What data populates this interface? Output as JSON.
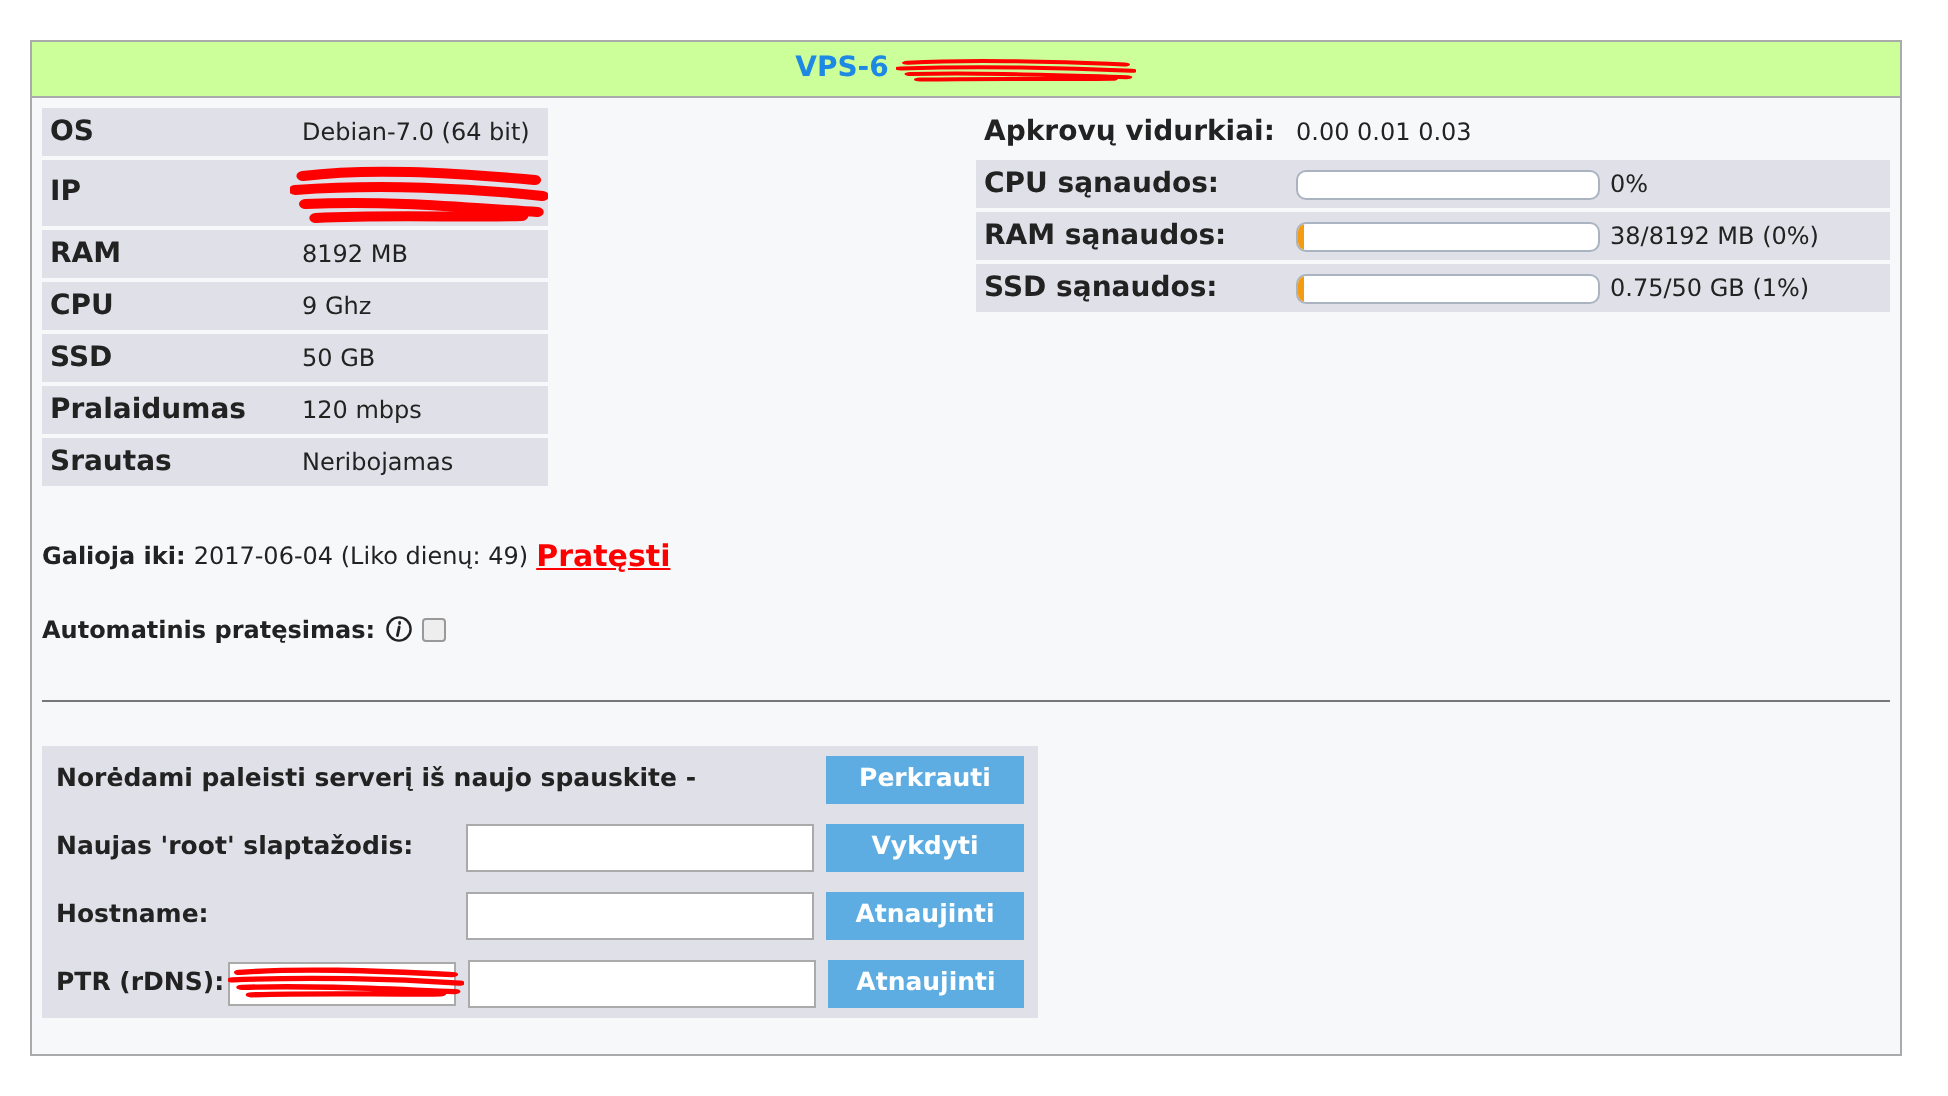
{
  "header": {
    "title": "VPS-6"
  },
  "specs": [
    {
      "label": "OS",
      "value": "Debian-7.0 (64 bit)"
    },
    {
      "label": "IP",
      "kind": "redacted"
    },
    {
      "label": "RAM",
      "value": "8192 MB"
    },
    {
      "label": "CPU",
      "value": "9 Ghz"
    },
    {
      "label": "SSD",
      "value": "50 GB"
    },
    {
      "label": "Pralaidumas",
      "value": "120 mbps"
    },
    {
      "label": "Srautas",
      "value": "Neribojamas"
    }
  ],
  "load": {
    "label": "Apkrovų vidurkiai:",
    "value": "0.00 0.01 0.03"
  },
  "usage": [
    {
      "label": "CPU sąnaudos:",
      "reading": "0%"
    },
    {
      "label": "RAM sąnaudos:",
      "level": 0.02,
      "reading": "38/8192 MB (0%)"
    },
    {
      "label": "SSD sąnaudos:",
      "level": 0.02,
      "reading": "0.75/50 GB (1%)"
    }
  ],
  "expiry": {
    "label": "Galioja iki:",
    "value": "2017-06-04 (Liko dienų: 49)",
    "link": "Pratęsti"
  },
  "auto_renew": {
    "label": "Automatinis pratęsimas:",
    "checked": false
  },
  "actions": [
    {
      "kind": "text",
      "label": "Norėdami paleisti serverį iš naujo spauskite -",
      "button": "Perkrauti"
    },
    {
      "kind": "input",
      "label": "Naujas 'root' slaptažodis:",
      "button": "Vykdyti"
    },
    {
      "kind": "input",
      "label": "Hostname:",
      "button": "Atnaujinti"
    },
    {
      "kind": "ptr",
      "label": "PTR (rDNS):",
      "button": "Atnaujinti"
    }
  ]
}
